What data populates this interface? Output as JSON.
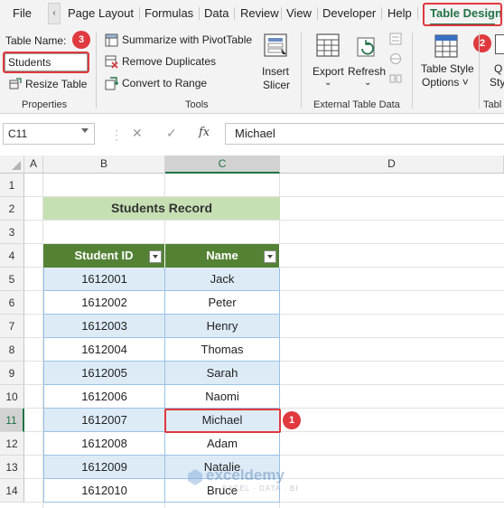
{
  "ribbon_tabs": [
    "File",
    "Page Layout",
    "Formulas",
    "Data",
    "Review",
    "View",
    "Developer",
    "Help",
    "Table Design"
  ],
  "tab_scroll_icon": "chevron-left-icon",
  "properties": {
    "table_name_label": "Table Name:",
    "table_name_value": "Students",
    "resize_label": "Resize Table",
    "group_label": "Properties"
  },
  "tools": {
    "summarize": "Summarize with PivotTable",
    "remove_duplicates": "Remove Duplicates",
    "convert": "Convert to Range",
    "insert_slicer_line1": "Insert",
    "insert_slicer_line2": "Slicer",
    "group_label": "Tools"
  },
  "external": {
    "export": "Export",
    "refresh": "Refresh",
    "group_label": "External Table Data"
  },
  "style_options": {
    "line1": "Table Style",
    "line2": "Options ˅",
    "partial_q": "Q",
    "partial_sty": "Sty",
    "partial_group": "Tabl"
  },
  "formula_bar": {
    "name_box": "C11",
    "cancel_glyph": "✕",
    "enter_glyph": "✓",
    "fx_glyph": "fx",
    "value": "Michael"
  },
  "columns": [
    "A",
    "B",
    "C",
    "D"
  ],
  "rows": [
    "1",
    "2",
    "3",
    "4",
    "5",
    "6",
    "7",
    "8",
    "9",
    "10",
    "11",
    "12",
    "13",
    "14"
  ],
  "table_title": "Students Record",
  "table": {
    "headers": [
      "Student ID",
      "Name"
    ],
    "rows": [
      [
        "1612001",
        "Jack"
      ],
      [
        "1612002",
        "Peter"
      ],
      [
        "1612003",
        "Henry"
      ],
      [
        "1612004",
        "Thomas"
      ],
      [
        "1612005",
        "Sarah"
      ],
      [
        "1612006",
        "Naomi"
      ],
      [
        "1612007",
        "Michael"
      ],
      [
        "1612008",
        "Adam"
      ],
      [
        "1612009",
        "Natalie"
      ],
      [
        "1612010",
        "Bruce"
      ]
    ]
  },
  "badges": [
    "1",
    "2",
    "3"
  ],
  "watermark": {
    "name": "exceldemy",
    "tagline": "EXCEL · DATA · BI"
  },
  "colors": {
    "accent": "#217346",
    "table_header": "#548235",
    "title_fill": "#c6e0b4",
    "band_fill": "#ddebf7",
    "highlight": "#e0393e"
  }
}
